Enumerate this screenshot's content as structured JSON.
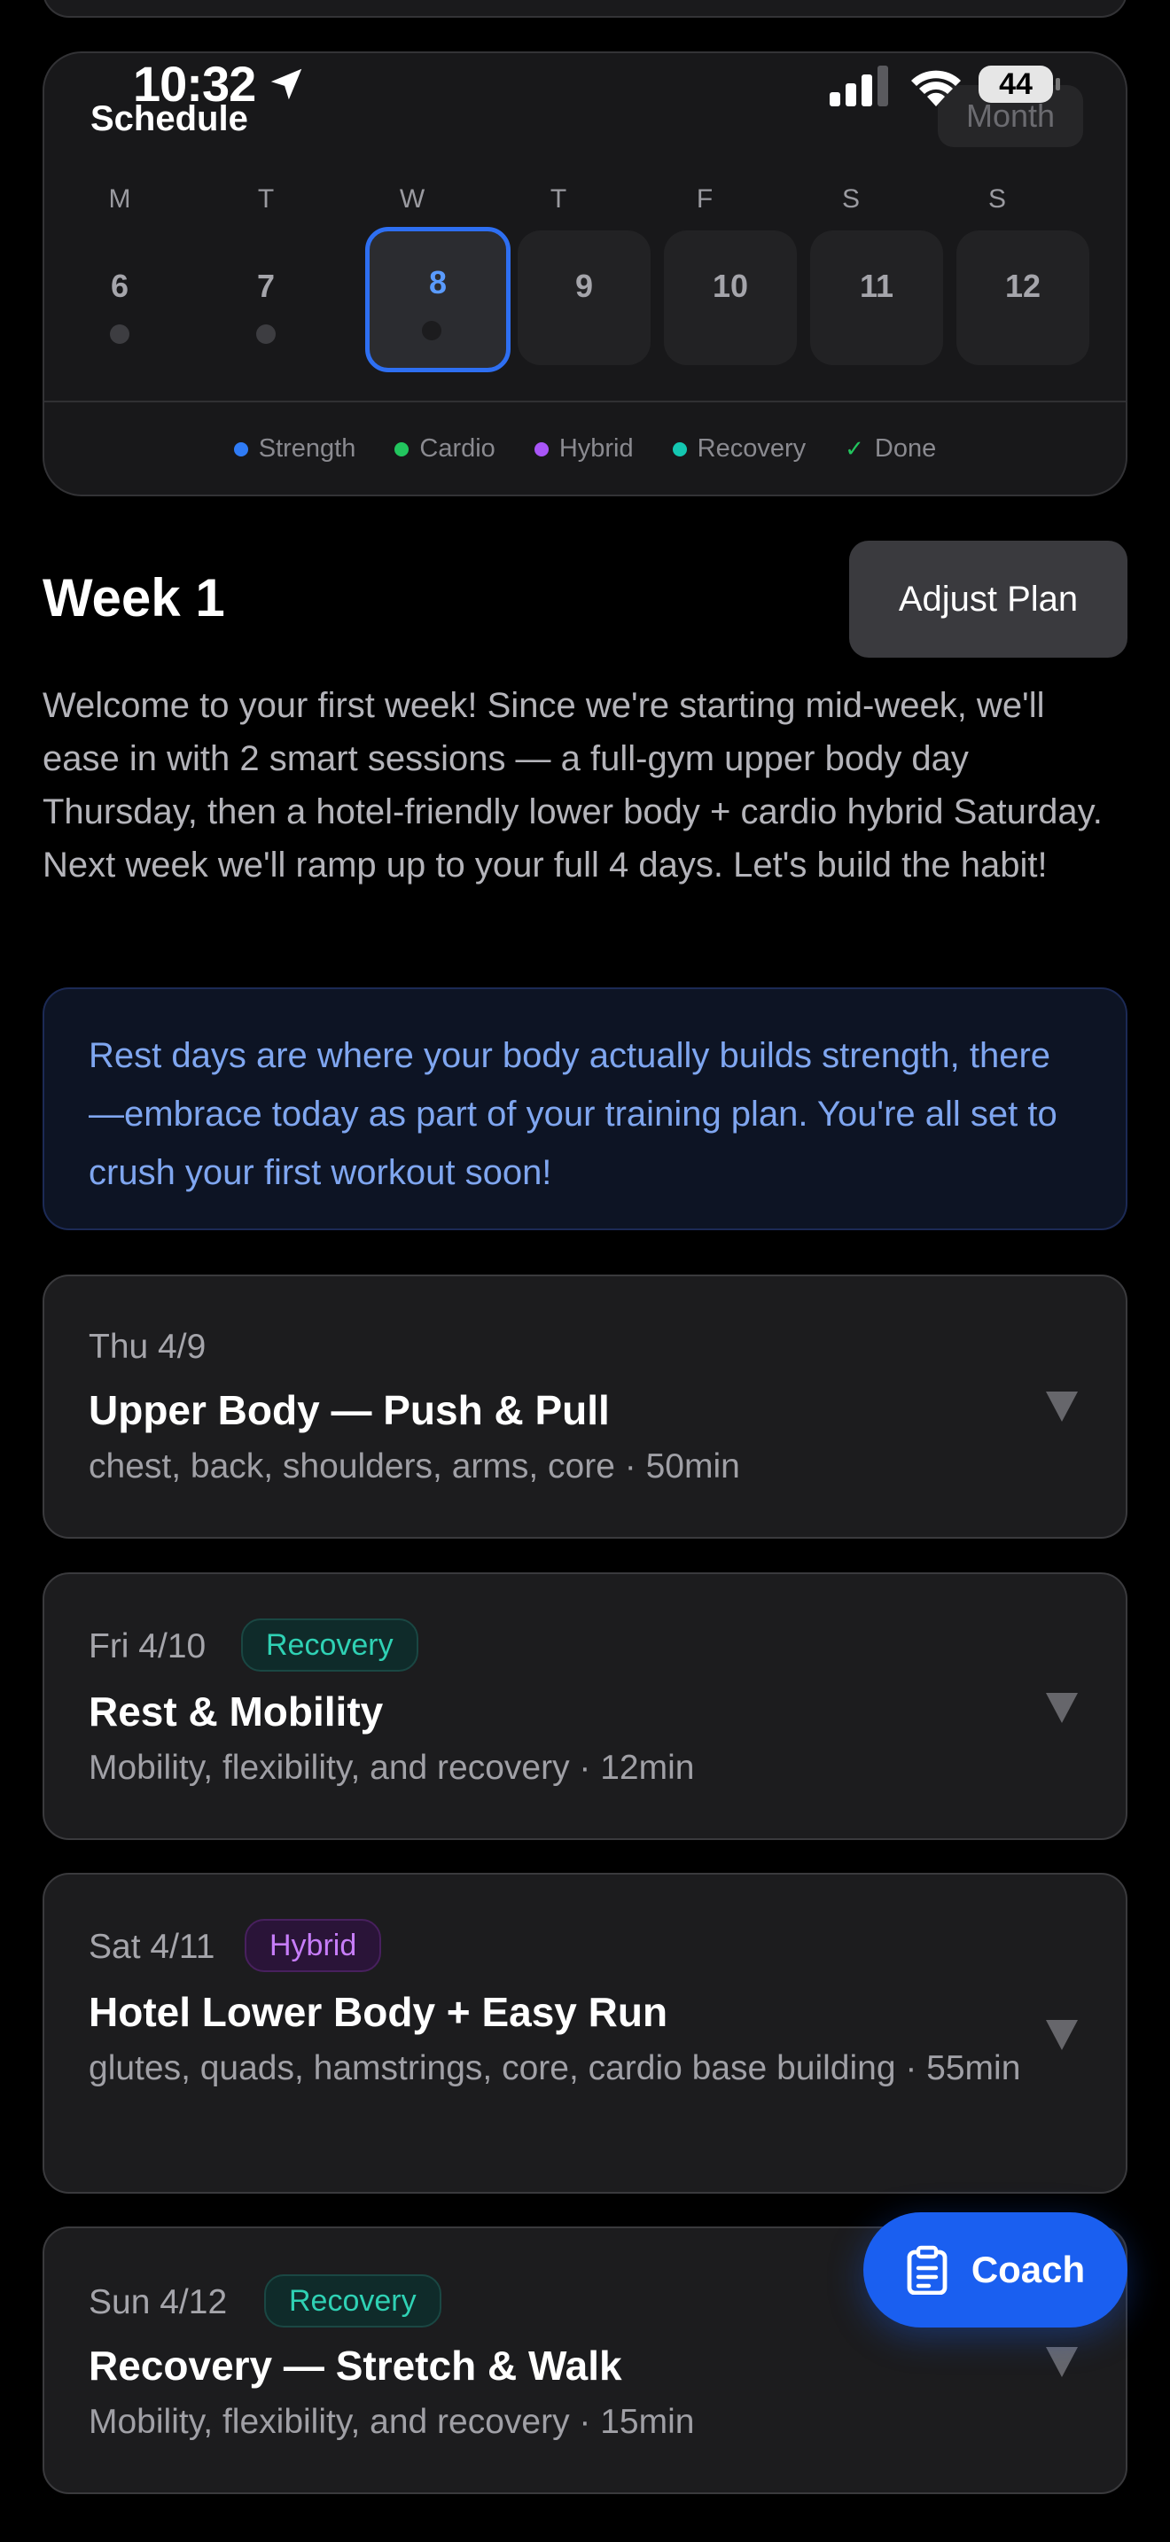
{
  "status_bar": {
    "time": "10:32",
    "battery": "44"
  },
  "schedule": {
    "title": "Schedule",
    "month_button": "Month",
    "weekdays": [
      "M",
      "T",
      "W",
      "T",
      "F",
      "S",
      "S"
    ],
    "days": [
      "6",
      "7",
      "8",
      "9",
      "10",
      "11",
      "12"
    ],
    "selected_day": "8",
    "legend": [
      {
        "label": "Strength",
        "color": "#2f7bf5"
      },
      {
        "label": "Cardio",
        "color": "#22c55e"
      },
      {
        "label": "Hybrid",
        "color": "#a855f7"
      },
      {
        "label": "Recovery",
        "color": "#14c7b1"
      },
      {
        "label": "Done",
        "color": "#22c55e"
      }
    ]
  },
  "week": {
    "title": "Week 1",
    "adjust_button": "Adjust Plan",
    "description": "Welcome to your first week! Since we're starting mid-week, we'll ease in with 2 smart sessions — a full-gym upper body day Thursday, then a hotel-friendly lower body + cardio hybrid Saturday. Next week we'll ramp up to your full 4 days. Let's build the habit!"
  },
  "info_message": "Rest days are where your body actually builds strength, there—embrace today as part of your training plan. You're all set to crush your first workout soon!",
  "workouts": [
    {
      "date": "Thu 4/9",
      "badge": "",
      "title": "Upper Body — Push & Pull",
      "subtitle": "chest, back, shoulders, arms, core · 50min"
    },
    {
      "date": "Fri 4/10",
      "badge": "Recovery",
      "title": "Rest & Mobility",
      "subtitle": "Mobility, flexibility, and recovery · 12min"
    },
    {
      "date": "Sat 4/11",
      "badge": "Hybrid",
      "title": "Hotel Lower Body + Easy Run",
      "subtitle": "glutes, quads, hamstrings, core, cardio base building · 55min"
    },
    {
      "date": "Sun 4/12",
      "badge": "Recovery",
      "title": "Recovery — Stretch & Walk",
      "subtitle": "Mobility, flexibility, and recovery · 15min"
    }
  ],
  "coach_button": "Coach",
  "colors": {
    "accent": "#1a5ff0",
    "selected_day": "#2e6ff2",
    "background": "#000000"
  }
}
